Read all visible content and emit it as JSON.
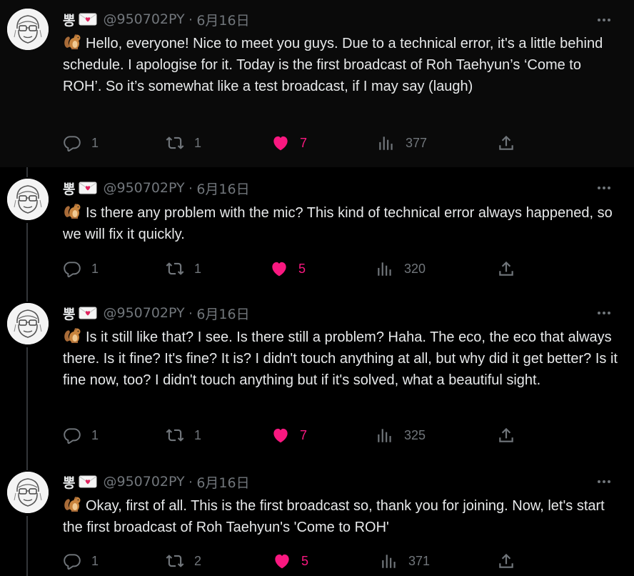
{
  "colors": {
    "background": "#000000",
    "text": "#e7e9ea",
    "muted": "#71767b",
    "like": "#f91880"
  },
  "tweets": [
    {
      "author_name": "뽕",
      "handle": "@950702PY",
      "date": "6月16日",
      "text": "Hello, everyone! Nice to meet you guys. Due to a technical error, it's a little behind schedule. I apologise for it. Today is the first broadcast of Roh Taehyun’s ‘Come to ROH’. So it’s somewhat like a test broadcast, if I may say (laugh)",
      "replies": "1",
      "retweets": "1",
      "likes": "7",
      "views": "377"
    },
    {
      "author_name": "뽕",
      "handle": "@950702PY",
      "date": "6月16日",
      "text": "Is there any problem with the mic? This kind of technical error always happened, so we will fix it quickly.",
      "replies": "1",
      "retweets": "1",
      "likes": "5",
      "views": "320"
    },
    {
      "author_name": "뽕",
      "handle": "@950702PY",
      "date": "6月16日",
      "text": "Is it still like that? I see. Is there still a problem? Haha. The eco, the eco that always there. Is it fine? It's fine? It is? I didn't touch anything at all, but why did it get better? Is it fine now, too? I didn't touch anything but if it's solved, what a beautiful sight.",
      "replies": "1",
      "retweets": "1",
      "likes": "7",
      "views": "325"
    },
    {
      "author_name": "뽕",
      "handle": "@950702PY",
      "date": "6月16日",
      "text": "Okay, first of all. This is the first broadcast so, thank you for joining. Now, let's start the first broadcast of Roh Taehyun's 'Come to ROH'",
      "replies": "1",
      "retweets": "2",
      "likes": "5",
      "views": "371"
    }
  ],
  "icons": {
    "author_badge": "love-letter-icon",
    "text_prefix": "chipmunk-icon",
    "reply": "reply-icon",
    "retweet": "retweet-icon",
    "like": "heart-icon",
    "views": "views-icon",
    "share": "share-icon",
    "more": "more-icon"
  }
}
